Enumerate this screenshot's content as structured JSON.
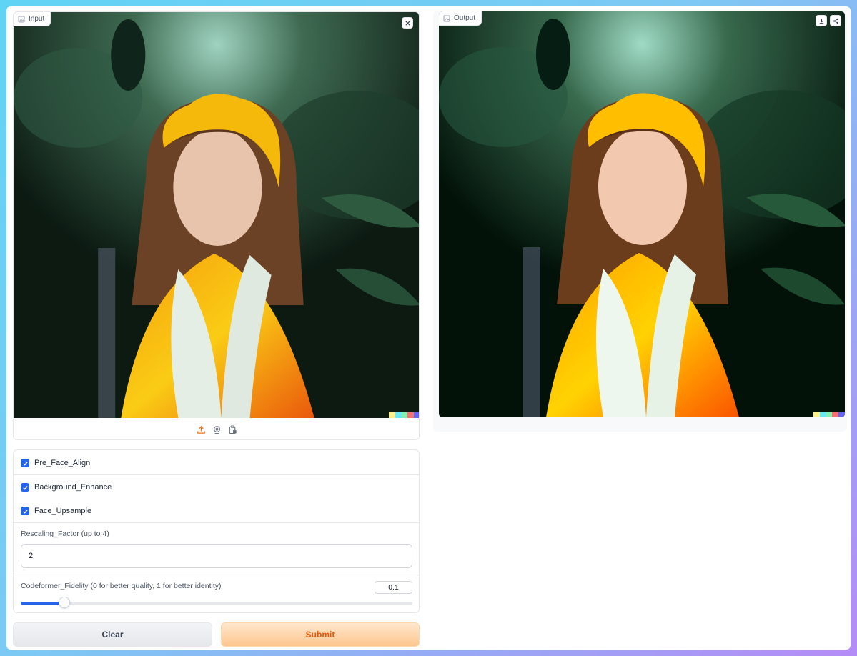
{
  "input_panel": {
    "label": "Input",
    "source_icons": [
      "upload-icon",
      "webcam-icon",
      "clipboard-icon"
    ],
    "clear_icon": "close-icon"
  },
  "output_panel": {
    "label": "Output",
    "action_icons": [
      "download-icon",
      "share-icon"
    ]
  },
  "image_palette": [
    "#fef08a",
    "#67e8f9",
    "#86efac",
    "#f87171",
    "#6366f1"
  ],
  "options": {
    "pre_face_align": {
      "label": "Pre_Face_Align",
      "checked": true
    },
    "background_enhance": {
      "label": "Background_Enhance",
      "checked": true
    },
    "face_upsample": {
      "label": "Face_Upsample",
      "checked": true
    },
    "rescaling": {
      "label": "Rescaling_Factor (up to 4)",
      "value": "2"
    },
    "fidelity": {
      "label": "Codeformer_Fidelity (0 for better quality, 1 for better identity)",
      "value": "0.1",
      "fraction": 0.1
    }
  },
  "buttons": {
    "clear": "Clear",
    "submit": "Submit"
  },
  "colors": {
    "accent": "#2563eb",
    "submit_text": "#ea580c"
  }
}
